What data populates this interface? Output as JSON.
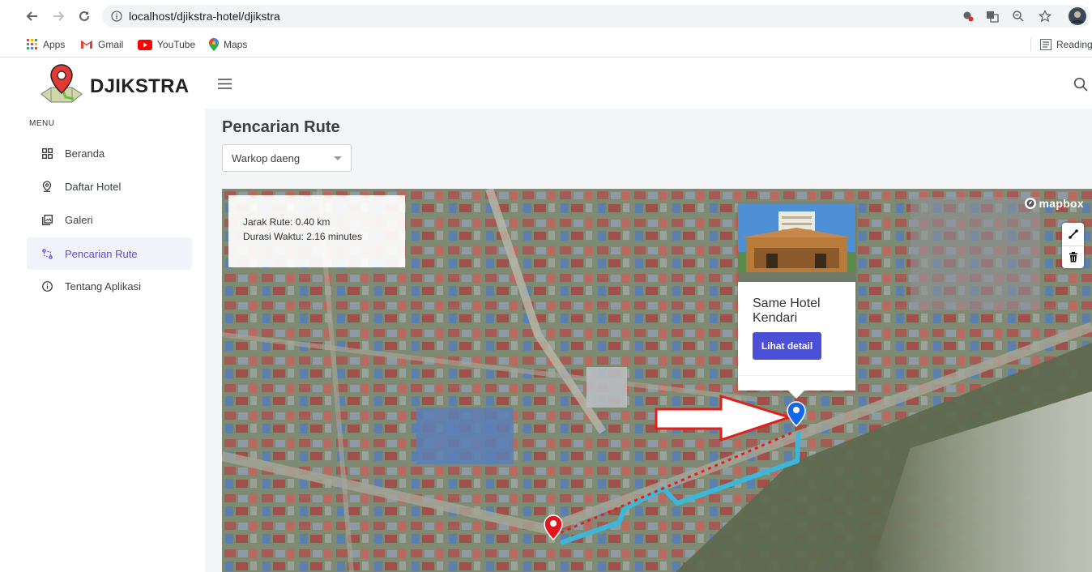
{
  "browser": {
    "url": "localhost/djikstra-hotel/djikstra",
    "bookmarks": [
      {
        "label": "Apps"
      },
      {
        "label": "Gmail"
      },
      {
        "label": "YouTube"
      },
      {
        "label": "Maps"
      }
    ],
    "reading_list": "Reading"
  },
  "app": {
    "brand": "DJIKSTRA",
    "menu_title": "MENU",
    "menu": [
      {
        "label": "Beranda",
        "icon": "grid-icon"
      },
      {
        "label": "Daftar Hotel",
        "icon": "location-pin-icon"
      },
      {
        "label": "Galeri",
        "icon": "gallery-icon"
      },
      {
        "label": "Pencarian Rute",
        "icon": "route-icon",
        "active": true
      },
      {
        "label": "Tentang Aplikasi",
        "icon": "info-icon"
      }
    ],
    "accent": "#5b4ed6"
  },
  "page": {
    "title": "Pencarian Rute",
    "select_value": "Warkop daeng"
  },
  "map": {
    "route_distance": "Jarak Rute: 0.40 km",
    "route_duration": "Durasi Waktu: 2.16 minutes",
    "attribution": "mapbox",
    "popup": {
      "title": "Same Hotel Kendari",
      "button": "Lihat detail"
    },
    "route_color": "#3bb7d9",
    "straight_line_color": "#e02020"
  }
}
